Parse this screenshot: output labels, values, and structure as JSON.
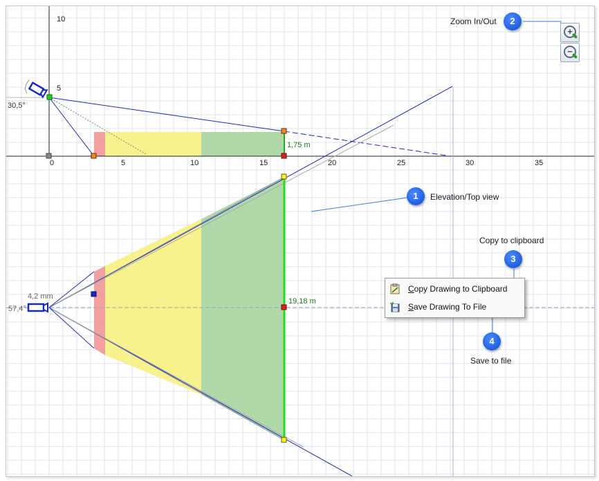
{
  "elevation_view": {
    "x_axis_ticks": [
      "0",
      "5",
      "10",
      "15",
      "20",
      "25",
      "30",
      "35"
    ],
    "y_axis_ticks": [
      "5",
      "10"
    ],
    "camera_tilt_angle": "30,5°",
    "target_height": "1,75 m"
  },
  "top_view": {
    "focal_length": "4,2 mm",
    "horizontal_angle": "57,4°",
    "field_width": "19,18 m"
  },
  "zones": {
    "red": "#f0908f",
    "yellow": "#f7f07a",
    "green": "#a9d4a0",
    "camera": "#1a27c8",
    "target_line": "#22dd22"
  },
  "callouts": [
    {
      "number": "1",
      "label": "Elevation/Top view"
    },
    {
      "number": "2",
      "label": "Zoom In/Out"
    },
    {
      "number": "3",
      "label": "Copy to clipboard"
    },
    {
      "number": "4",
      "label": "Save to file"
    }
  ],
  "zoom": {
    "in_icon": "zoom-in-magnifier-icon",
    "out_icon": "zoom-out-magnifier-icon"
  },
  "context_menu": {
    "items": [
      {
        "label": "Copy Drawing to Clipboard",
        "icon": "clipboard-icon"
      },
      {
        "label": "Save Drawing To File",
        "icon": "floppy-disk-icon"
      }
    ]
  }
}
